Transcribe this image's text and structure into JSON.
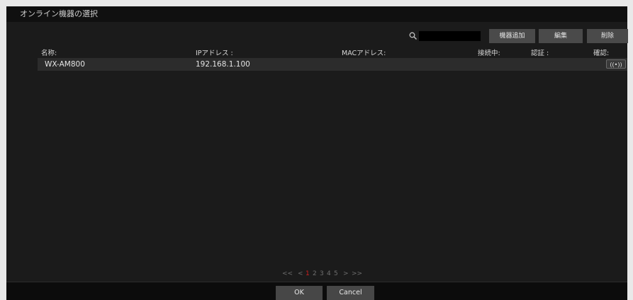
{
  "window": {
    "title": "オンライン機器の選択"
  },
  "toolbar": {
    "search_icon": "search-icon",
    "search_value": "",
    "add_device_label": "機器追加",
    "edit_label": "編集",
    "delete_label": "削除"
  },
  "table": {
    "headers": {
      "name": "名称:",
      "ip": "IPアドレス :",
      "mac": "MACアドレス:",
      "connected": "接続中:",
      "auth": "認証 :",
      "confirm": "確認:"
    },
    "rows": [
      {
        "name": "WX-AM800",
        "ip": "192.168.1.100",
        "mac": "",
        "connected": "",
        "auth": "",
        "confirm_button": "((•))"
      }
    ]
  },
  "pager": {
    "first": "<<",
    "prev": "<",
    "pages": [
      "1",
      "2",
      "3",
      "4",
      "5"
    ],
    "current_page": "1",
    "next": ">",
    "last": ">>"
  },
  "footer": {
    "ok_label": "OK",
    "cancel_label": "Cancel"
  },
  "colors": {
    "background": "#1b1b1b",
    "button": "#4a4a4a",
    "current_page": "#d02020"
  }
}
